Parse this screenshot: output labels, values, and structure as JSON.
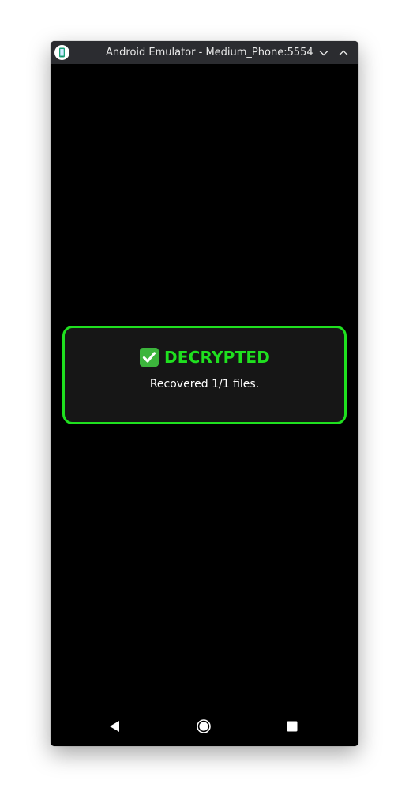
{
  "window": {
    "title": "Android Emulator - Medium_Phone:5554",
    "icons": {
      "app": "android-emulator-icon",
      "minimize": "chevron-down-icon",
      "maximize": "chevron-up-icon"
    }
  },
  "status_card": {
    "icon": "check-mark-button-icon",
    "title": "DECRYPTED",
    "message": "Recovered 1/1 files."
  },
  "navigation_bar": {
    "back": "back-triangle-icon",
    "home": "home-circle-icon",
    "recents": "recents-square-icon"
  },
  "colors": {
    "accent": "#1fe01f",
    "card_background": "#161616",
    "screen_background": "#000000",
    "title_bar": "#2b2c30"
  }
}
